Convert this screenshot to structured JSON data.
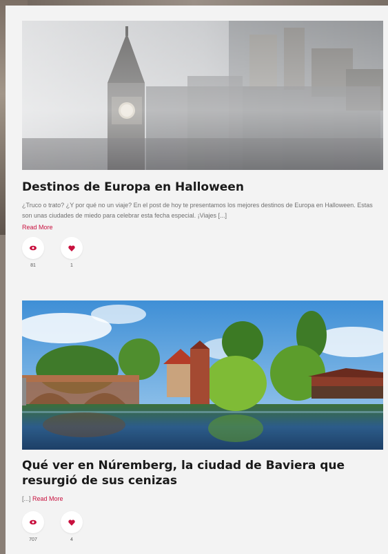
{
  "posts": [
    {
      "title": "Destinos de Europa en Halloween",
      "excerpt": "¿Truco o trato? ¿Y por qué no un viaje? En el post de hoy te presentamos los mejores destinos de Europa en Halloween. Estas son unas ciudades de miedo para celebrar esta fecha especial. ¡Viajes [...]",
      "read_more": "Read More",
      "views": "81",
      "likes": "1",
      "image_icon": "foggy-london-big-ben-photo"
    },
    {
      "title": "Qué ver en Núremberg, la ciudad de Baviera que resurgió de sus cenizas",
      "excerpt": "[...]",
      "read_more": "Read More",
      "views": "707",
      "likes": "4",
      "image_icon": "nuremberg-river-bridge-photo"
    }
  ],
  "colors": {
    "accent": "#c8103e",
    "background": "#f3f3f3",
    "title": "#1a1a1a"
  },
  "icons": {
    "views": "eye-icon",
    "likes": "heart-icon"
  }
}
